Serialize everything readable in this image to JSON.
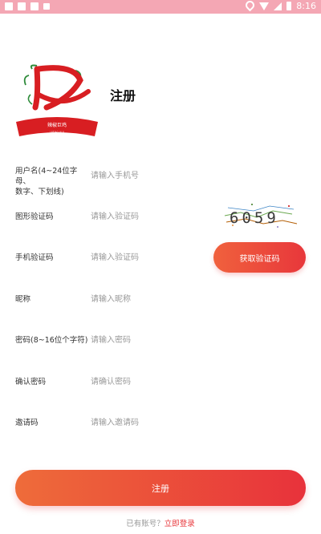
{
  "status_bar": {
    "time": "8:16"
  },
  "logo": {
    "brand_text": "辣椒巨鸡",
    "sub_text": "LATIAO JU JI"
  },
  "page_title": "注册",
  "form": {
    "rows": [
      {
        "label_line1": "用户名(4~24位字母、",
        "label_line2": "数字、下划线)",
        "placeholder": "请输入手机号",
        "value": ""
      },
      {
        "label_line1": "图形验证码",
        "label_line2": "",
        "placeholder": "请输入验证码",
        "value": ""
      },
      {
        "label_line1": "手机验证码",
        "label_line2": "",
        "placeholder": "请输入验证码",
        "value": ""
      },
      {
        "label_line1": "昵称",
        "label_line2": "",
        "placeholder": "请输入昵称",
        "value": ""
      },
      {
        "label_line1": "密码(8~16位个字符)",
        "label_line2": "",
        "placeholder": "请输入密码",
        "value": ""
      },
      {
        "label_line1": "确认密码",
        "label_line2": "",
        "placeholder": "请确认密码",
        "value": ""
      },
      {
        "label_line1": "邀请码",
        "label_line2": "",
        "placeholder": "请输入邀请码",
        "value": ""
      }
    ]
  },
  "captcha": {
    "text": "6059"
  },
  "get_code_button": "获取验证码",
  "register_button": "注册",
  "footer": {
    "prompt": "已有账号？",
    "login_link": "立即登录"
  },
  "colors": {
    "status_bar": "#f4a7b4",
    "accent": "#e8373b",
    "accent_start": "#f0613d"
  }
}
